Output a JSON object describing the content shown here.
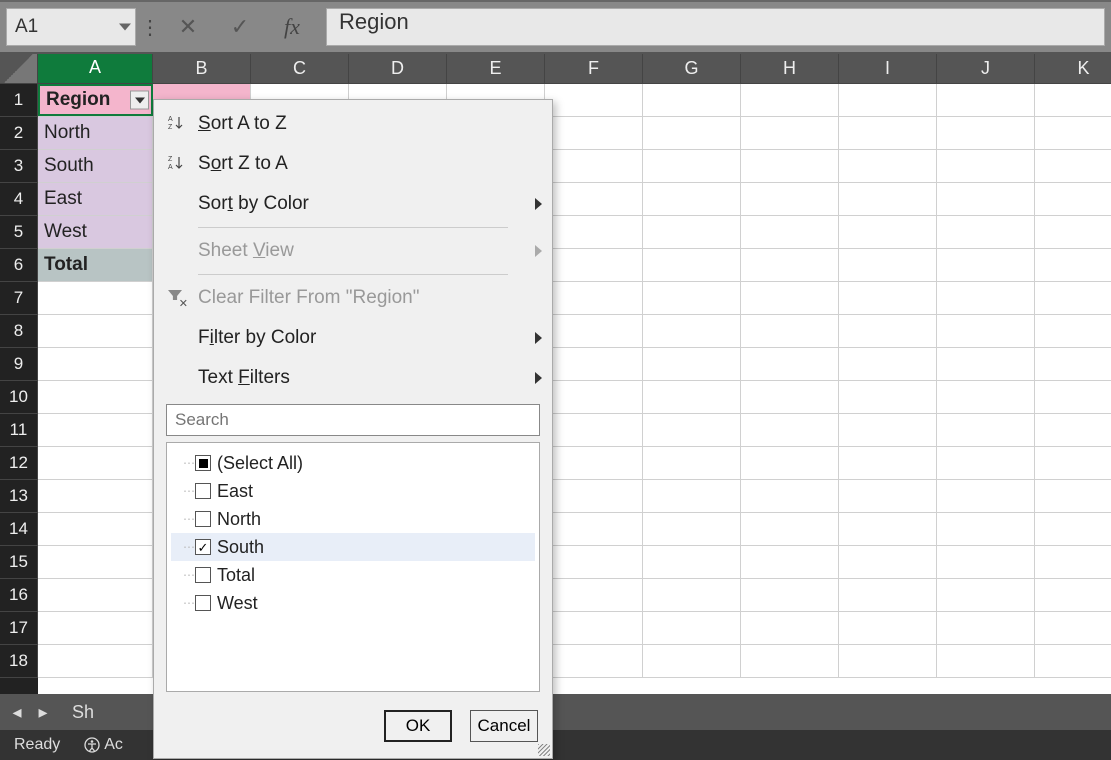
{
  "formula_bar": {
    "name_box": "A1",
    "cancel": "✕",
    "confirm": "✓",
    "fx": "fx",
    "value": "Region"
  },
  "columns": [
    "A",
    "B",
    "C",
    "D",
    "E",
    "F",
    "G",
    "H",
    "I",
    "J",
    "K"
  ],
  "rows_visible": 18,
  "cells": {
    "A1": "Region",
    "A2": "North",
    "A3": "South",
    "A4": "East",
    "A5": "West",
    "A6": "Total"
  },
  "context_menu": {
    "sort_az": "Sort A to Z",
    "sort_za": "Sort Z to A",
    "sort_color": "Sort by Color",
    "sheet_view": "Sheet View",
    "clear_filter": "Clear Filter From \"Region\"",
    "filter_color": "Filter by Color",
    "text_filters": "Text Filters",
    "search_placeholder": "Search",
    "items": {
      "select_all": "(Select All)",
      "east": "East",
      "north": "North",
      "south": "South",
      "total": "Total",
      "west": "West"
    },
    "ok": "OK",
    "cancel": "Cancel"
  },
  "sheet_tab": "Sh",
  "status": {
    "ready": "Ready",
    "acc": "Ac"
  }
}
